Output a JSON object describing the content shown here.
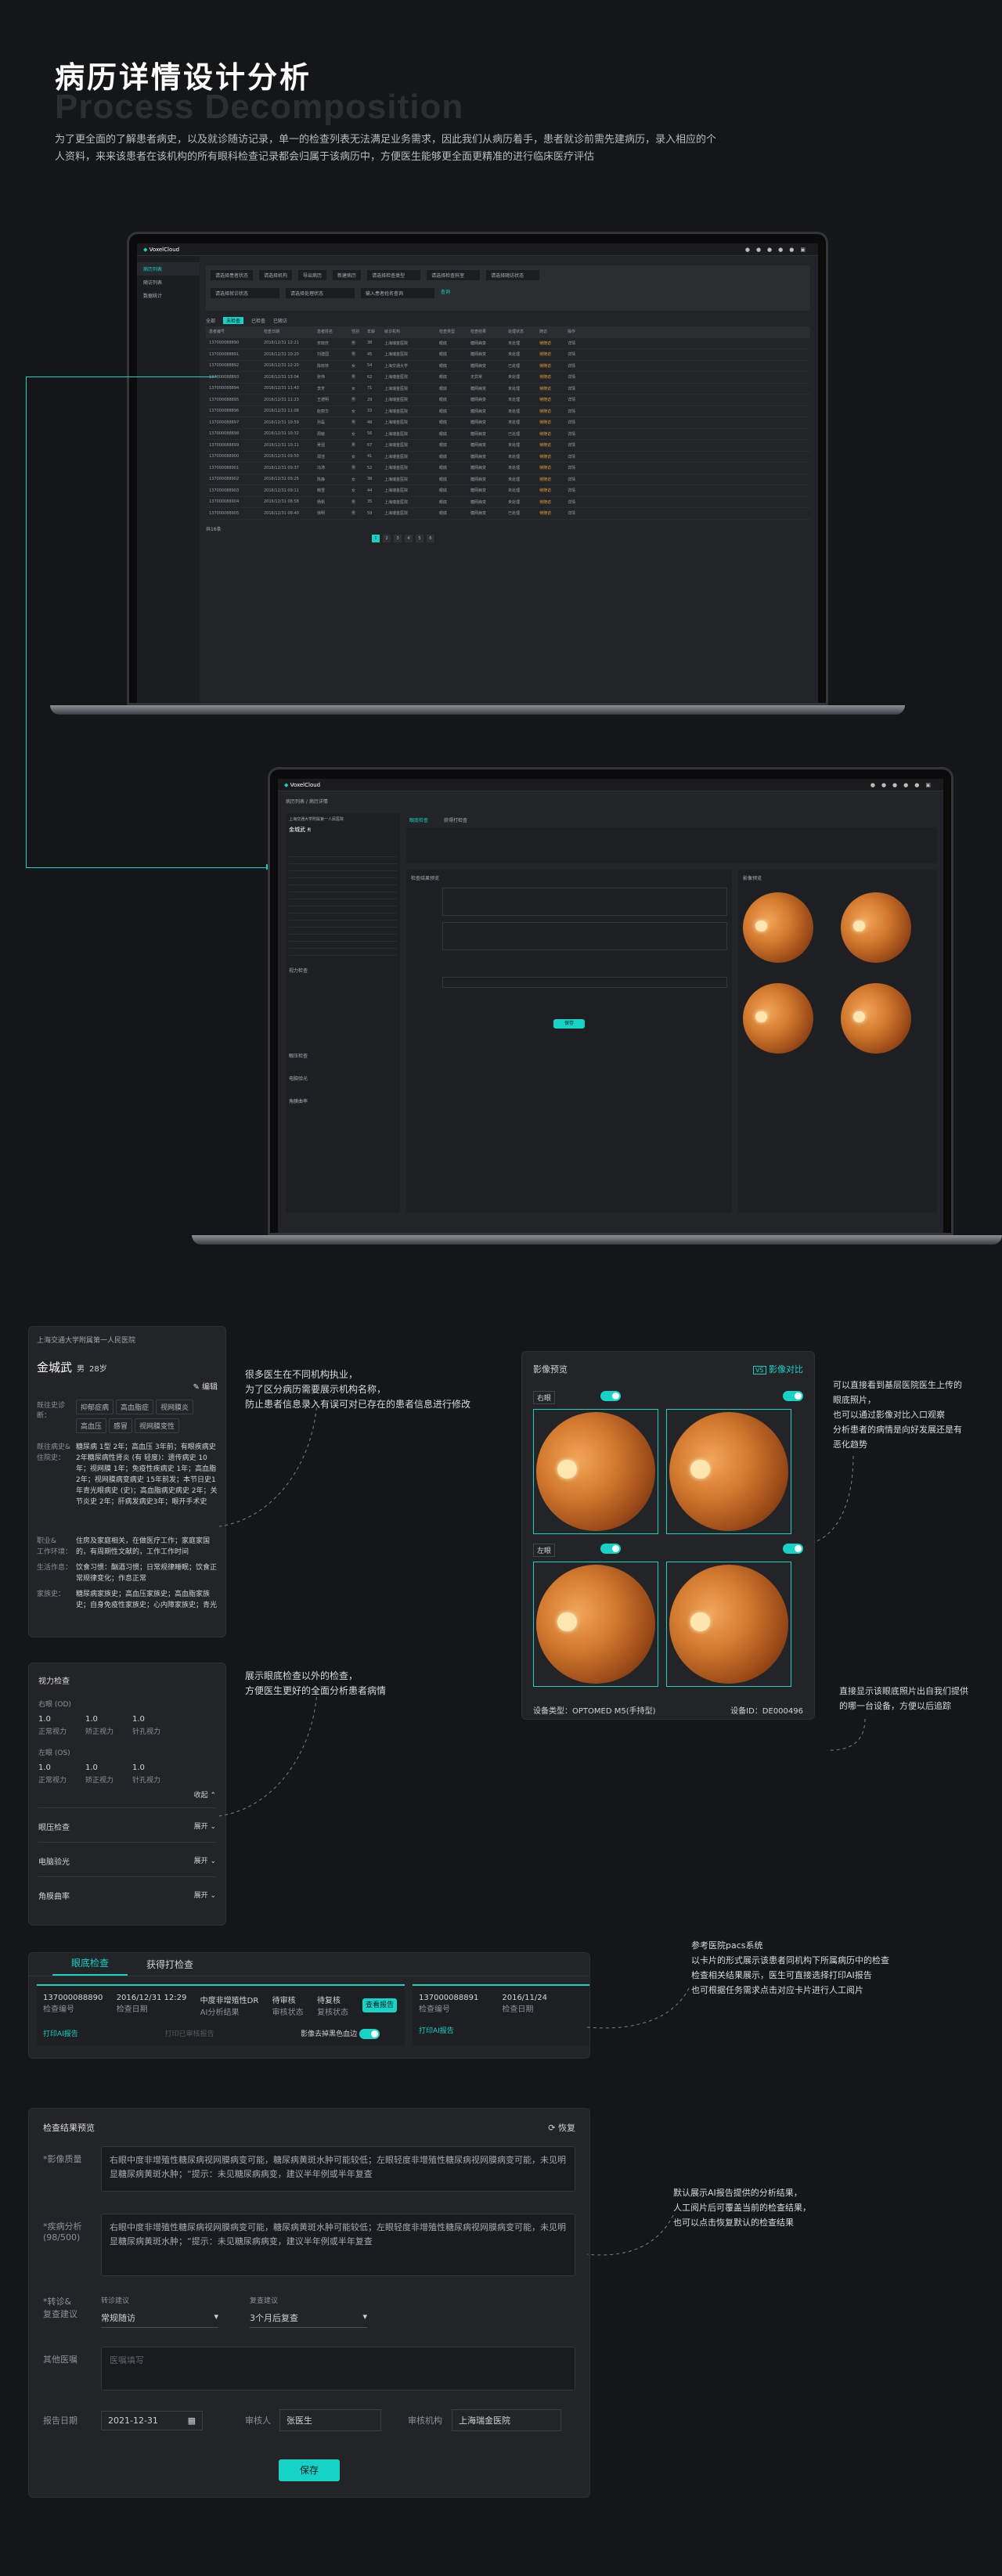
{
  "header": {
    "title": "病历详情设计分析",
    "ghost": "Process Decomposition",
    "desc": "为了更全面的了解患者病史，以及就诊随访记录，单一的检查列表无法满足业务需求，因此我们从病历着手，患者就诊前需先建病历，录入相应的个人资料，来来该患者在该机构的所有眼科检查记录都会归属于该病历中，方便医生能够更全面更精准的进行临床医疗评估"
  },
  "app1": {
    "brand": "VoxelCloud",
    "nav": [
      "病历列表",
      "随访列表",
      "数据统计"
    ],
    "filters": [
      "请选择患者状态",
      "请选择机构",
      "导出病历",
      "新建病历",
      "请选择检查类型",
      "请选择检查科室",
      "请选择随访状态",
      "请选择就诊状态",
      "请选择处理状态"
    ],
    "search_ph": "输入患者姓名查询",
    "search_btn": "查询",
    "tabs": [
      "全部",
      "未检查",
      "已检查",
      "已随访"
    ],
    "cols": [
      "患者编号",
      "检查日期",
      "患者姓名",
      "性别",
      "年龄",
      "就诊机构",
      "检查类型",
      "检查结果",
      "处理状态",
      "随访",
      "操作"
    ],
    "rows": [
      [
        "137000088890",
        "2016/12/31 12:21",
        "宋晓庆",
        "男",
        "38",
        "上海瑞金医院",
        "眼底",
        "糖网病变",
        "未处理",
        "待随访",
        "详情"
      ],
      [
        "137000088891",
        "2016/12/31 10:20",
        "刘建国",
        "男",
        "45",
        "上海瑞金医院",
        "眼底",
        "糖网病变",
        "未处理",
        "待随访",
        "详情"
      ],
      [
        "137000088892",
        "2016/12/31 12:20",
        "陈晓林",
        "女",
        "54",
        "上海交通大学",
        "眼底",
        "糖网病变",
        "已处理",
        "待随访",
        "详情"
      ],
      [
        "137000088893",
        "2016/12/31 13:04",
        "张伟",
        "男",
        "62",
        "上海瑞金医院",
        "眼底",
        "无异常",
        "未处理",
        "待随访",
        "详情"
      ],
      [
        "137000088894",
        "2016/12/31 11:43",
        "李芳",
        "女",
        "71",
        "上海瑞金医院",
        "眼底",
        "糖网病变",
        "未处理",
        "待随访",
        "详情"
      ],
      [
        "137000088895",
        "2016/12/31 11:23",
        "王德明",
        "男",
        "29",
        "上海瑞金医院",
        "眼底",
        "糖网病变",
        "未处理",
        "待随访",
        "详情"
      ],
      [
        "137000088896",
        "2016/12/31 11:08",
        "赵丽华",
        "女",
        "33",
        "上海瑞金医院",
        "眼底",
        "糖网病变",
        "未处理",
        "待随访",
        "详情"
      ],
      [
        "137000088897",
        "2016/12/31 10:59",
        "孙磊",
        "男",
        "48",
        "上海瑞金医院",
        "眼底",
        "糖网病变",
        "未处理",
        "待随访",
        "详情"
      ],
      [
        "137000088898",
        "2016/12/31 10:32",
        "周敏",
        "女",
        "56",
        "上海瑞金医院",
        "眼底",
        "糖网病变",
        "已处理",
        "待随访",
        "详情"
      ],
      [
        "137000088899",
        "2016/12/31 10:11",
        "吴强",
        "男",
        "67",
        "上海瑞金医院",
        "眼底",
        "糖网病变",
        "未处理",
        "待随访",
        "详情"
      ],
      [
        "137000088900",
        "2016/12/31 09:50",
        "郑洁",
        "女",
        "41",
        "上海瑞金医院",
        "眼底",
        "糖网病变",
        "未处理",
        "待随访",
        "详情"
      ],
      [
        "137000088901",
        "2016/12/31 09:37",
        "冯涛",
        "男",
        "52",
        "上海瑞金医院",
        "眼底",
        "糖网病变",
        "未处理",
        "待随访",
        "详情"
      ],
      [
        "137000088902",
        "2016/12/31 09:25",
        "陈静",
        "女",
        "38",
        "上海瑞金医院",
        "眼底",
        "糖网病变",
        "未处理",
        "待随访",
        "详情"
      ],
      [
        "137000088903",
        "2016/12/31 09:11",
        "韩雪",
        "女",
        "44",
        "上海瑞金医院",
        "眼底",
        "糖网病变",
        "未处理",
        "待随访",
        "详情"
      ],
      [
        "137000088904",
        "2016/12/31 08:58",
        "杨帆",
        "男",
        "35",
        "上海瑞金医院",
        "眼底",
        "糖网病变",
        "未处理",
        "待随访",
        "详情"
      ],
      [
        "137000088905",
        "2016/12/31 08:40",
        "徐明",
        "男",
        "59",
        "上海瑞金医院",
        "眼底",
        "糖网病变",
        "已处理",
        "待随访",
        "详情"
      ]
    ],
    "total": "共16条",
    "pages": [
      "1",
      "2",
      "3",
      "4",
      "5",
      "6"
    ]
  },
  "app2": {
    "breadcrumb": "病历列表 / 病历详情",
    "tabs": [
      "眼底检查",
      "获得打检查"
    ]
  },
  "patient": {
    "hospital": "上海交通大学附属第一人民医院",
    "name": "金城武",
    "gender": "男",
    "age": "28岁",
    "edit": "编辑",
    "diag_label": "既往史诊断：",
    "tags": [
      "抑郁症病",
      "高血脂症",
      "视网膜炎",
      "高血压",
      "感冒",
      "视网膜变性"
    ],
    "history_label": "既往病史&\n住院史：",
    "history": "糖尿病 1型 2年；高血压 3年前；有眼疾病史2年糖尿病性肾炎 (有 轻度)：遗传病史 10年；视网膜 1年；免疫性疾病史 1年；高血脂 2年；视网膜病变病史 15年前发；本节日史1年青光眼病史 (史)；高血脂病史病史 2年；关节炎史 2年；肝病发病史3年；眼开手术史",
    "work_label": "职业&\n工作环境：",
    "work": "住房及家庭相关，在做医疗工作；家庭家国的，有周期性文献的，工作工作时间",
    "habit_label": "生活作息：",
    "habit": "饮食习惯：酗酒习惯；日常规律睡眠；饮食正常规律变化；作息正常",
    "family_label": "家族史：",
    "family": "糖尿病家族史；高血压家族史；高血脂家族史；自身免疫性家族史；心内障家族史；青光眼家族史"
  },
  "vision": {
    "title": "视力检查",
    "right": "右眼 (OD)",
    "left": "左眼 (OS)",
    "od": [
      "1.0",
      "1.0",
      "1.0"
    ],
    "os": [
      "1.0",
      "1.0",
      "1.0"
    ],
    "labels": [
      "正常视力",
      "矫正视力",
      "针孔视力"
    ],
    "fold": "收起",
    "rows": [
      "眼压检查",
      "电脑验光",
      "角膜曲率"
    ],
    "expand": "展开"
  },
  "images": {
    "title": "影像预览",
    "compare": "影像对比",
    "right": "右眼",
    "left": "左眼",
    "device_label": "设备类型：",
    "device": "OPTOMED M5(手持型)",
    "devno_label": "设备ID：",
    "devno": "DE000496"
  },
  "exam": {
    "tabs": [
      "眼底检查",
      "获得打检查"
    ],
    "card1": [
      "137000088890",
      "检查编号",
      "2016/12/31 12:29",
      "检查日期",
      "中度非增殖性DR",
      "AI分析结果",
      "待审核",
      "审核状态",
      "待复核",
      "复核状态"
    ],
    "card2": [
      "137000088891",
      "检查编号",
      "2016/11/24",
      "检查日期"
    ],
    "btn": "查看报告",
    "ai_report": "打印AI报告",
    "print_report": "打印已审核报告",
    "switch": "影像去掉黑色血边",
    "ai_report2": "打印AI报告"
  },
  "result": {
    "title": "检查结果预览",
    "restore": "恢复",
    "img_label": "*影像质量",
    "img_text": "右眼中度非增殖性糖尿病视网膜病变可能，糖尿病黄斑水肿可能较低；左眼轻度非增殖性糖尿病视网膜病变可能，未见明显糖尿病黄斑水肿；“提示：未见糖尿病病变，建议半年例或半年复查",
    "ai_label": "*疾病分析",
    "ai_sub": "(98/500)",
    "ai_text": "右眼中度非增殖性糖尿病视网膜病变可能，糖尿病黄斑水肿可能较低；左眼轻度非增殖性糖尿病视网膜病变可能，未见明显糖尿病黄斑水肿；“提示：未见糖尿病病变，建议半年例或半年复查",
    "visit_label": "*转诊&\n复查建议",
    "visit1_label": "转诊建议",
    "visit1": "常规随访",
    "visit2_label": "复查建议",
    "visit2": "3个月后复查",
    "other_label": "其他医嘱",
    "other_ph": "医嘱填写",
    "date_label": "报告日期",
    "date": "2021-12-31",
    "reviewer_label": "审核人",
    "reviewer": "张医生",
    "org_label": "审核机构",
    "org": "上海瑞金医院",
    "save": "保存"
  },
  "notes": {
    "n1": "很多医生在不同机构执业，\n为了区分病历需要展示机构名称，\n防止患者信息录入有误可对已存在的患者信息进行修改",
    "n2": "展示眼底检查以外的检查，\n方便医生更好的全面分析患者病情",
    "n3": "可以直接看到基层医院医生上传的\n眼底照片，\n也可以通过影像对比入口观察\n分析患者的病情是向好发展还是有\n恶化趋势",
    "n4": "直接显示该眼底照片出自我们提供\n的哪一台设备，方便以后追踪",
    "n5": "参考医院pacs系统\n以卡片的形式展示该患者同机构下所属病历中的检查\n检查相关结果展示，医生可直接选择打印AI报告\n也可根据任务需求点击对应卡片进行人工阅片",
    "n6": "默认展示AI报告提供的分析结果，\n人工阅片后可覆盖当前的检查结果，\n也可以点击恢复默认的检查结果"
  }
}
